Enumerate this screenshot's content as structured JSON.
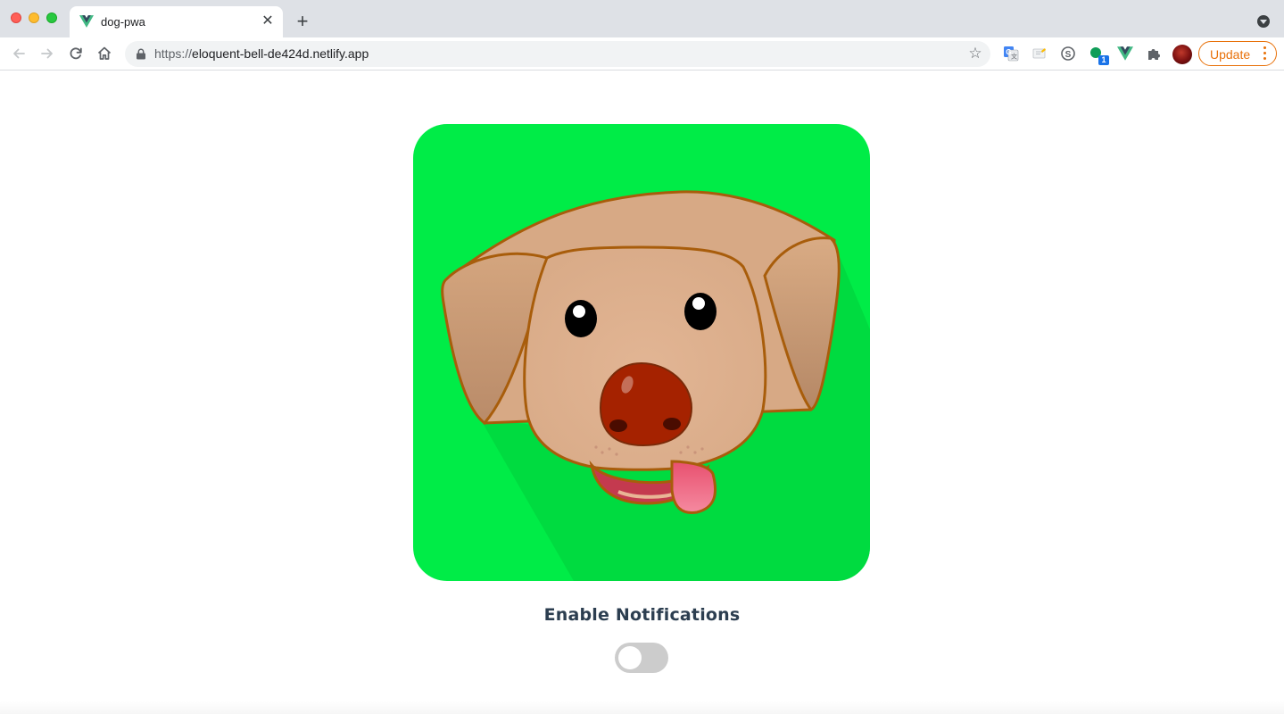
{
  "browser": {
    "tab": {
      "title": "dog-pwa",
      "favicon": "vue-logo-icon",
      "close_glyph": "✕"
    },
    "new_tab_glyph": "+",
    "address_bar": {
      "scheme": "https://",
      "host": "eloquent-bell-de424d.netlify.app"
    },
    "bookmark_glyph": "☆",
    "extension_badge": "1",
    "update_label": "Update",
    "colors": {
      "tabstrip": "#dee1e6",
      "update_accent": "#e8710a",
      "badge": "#1a73e8"
    }
  },
  "page": {
    "image": {
      "subject": "dog-face-icon",
      "background": "#00ec47"
    },
    "notifications": {
      "label": "Enable Notifications",
      "enabled": false
    }
  }
}
